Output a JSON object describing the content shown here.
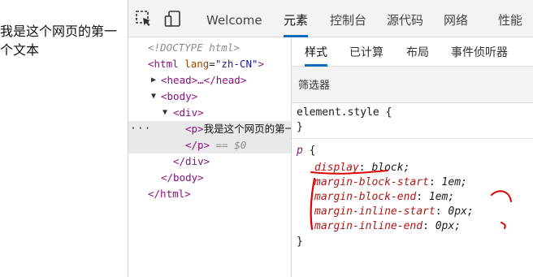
{
  "page": {
    "text": "我是这个网页的第一个文本"
  },
  "toolbar": {
    "inspect_icon": "inspect-element-icon",
    "device_icon": "device-emulation-icon",
    "tabs": [
      {
        "label": "Welcome"
      },
      {
        "label": "元素"
      },
      {
        "label": "控制台"
      },
      {
        "label": "源代码"
      },
      {
        "label": "网络"
      },
      {
        "label": "性能"
      }
    ],
    "active_tab": "元素",
    "accent": "#0f6cbd"
  },
  "elements": {
    "doctype": "<!DOCTYPE html>",
    "html_tag": "html",
    "html_attr_name": "lang",
    "html_attr_value": "\"zh-CN\"",
    "head_collapsed": "<head>…</head>",
    "body_open": "<body>",
    "div_open": "<div>",
    "p_open": "<p>",
    "p_text": "我是这个网页的第一个文本",
    "p_close": "</p>",
    "selected_marker": "== $0",
    "div_close": "</div>",
    "body_close": "</body>",
    "html_close": "</html>",
    "dots": "···"
  },
  "styles": {
    "subtabs": [
      {
        "label": "样式"
      },
      {
        "label": "已计算"
      },
      {
        "label": "布局"
      },
      {
        "label": "事件侦听器"
      }
    ],
    "active_subtab": "样式",
    "filter_placeholder": "筛选器",
    "element_style_open": "element.style {",
    "element_style_close": "}",
    "rule_selector": "p",
    "rule_open": " {",
    "rule_close": "}",
    "declarations": [
      {
        "prop": "display",
        "value": "block;"
      },
      {
        "prop": "margin-block-start",
        "value": "1em;"
      },
      {
        "prop": "margin-block-end",
        "value": "1em;"
      },
      {
        "prop": "margin-inline-start",
        "value": "0px;"
      },
      {
        "prop": "margin-inline-end",
        "value": "0px;"
      }
    ],
    "annotation_color": "#e00000"
  }
}
